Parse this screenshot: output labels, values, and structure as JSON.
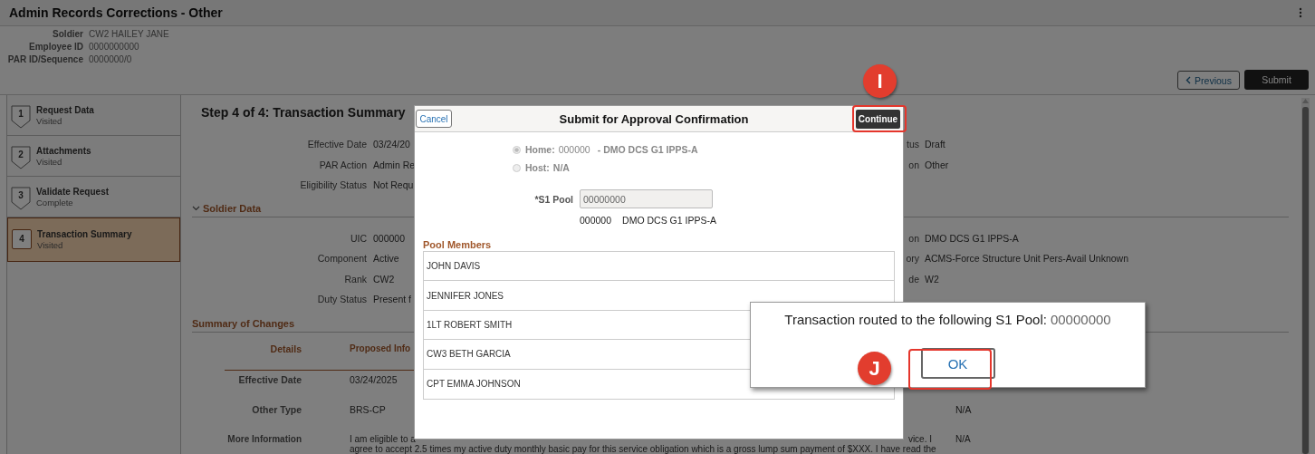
{
  "header": {
    "title": "Admin Records Corrections - Other"
  },
  "soldier_info": [
    {
      "label": "Soldier",
      "value": "CW2 HAILEY JANE"
    },
    {
      "label": "Employee ID",
      "value": "0000000000"
    },
    {
      "label": "PAR ID/Sequence",
      "value": "0000000/0"
    }
  ],
  "actions": {
    "previous": "Previous",
    "submit": "Submit"
  },
  "steps": [
    {
      "number": "1",
      "title": "Request Data",
      "status": "Visited",
      "selected": false
    },
    {
      "number": "2",
      "title": "Attachments",
      "status": "Visited",
      "selected": false
    },
    {
      "number": "3",
      "title": "Validate Request",
      "status": "Complete",
      "selected": false
    },
    {
      "number": "4",
      "title": "Transaction Summary",
      "status": "Visited",
      "selected": true
    }
  ],
  "main": {
    "step_title": "Step 4 of 4: Transaction Summary",
    "fields": [
      {
        "label": "Effective Date",
        "value": "03/24/20",
        "right_label": "tus",
        "right_value": "Draft"
      },
      {
        "label": "PAR Action",
        "value": "Admin Re",
        "right_label": "on",
        "right_value": "Other"
      },
      {
        "label": "Eligibility Status",
        "value": "Not Requ"
      }
    ],
    "soldier_data": {
      "title": "Soldier Data",
      "expanded": true,
      "fields": [
        {
          "label": "UIC",
          "value": "000000",
          "right_label": "on",
          "right_value": "DMO DCS G1 IPPS-A"
        },
        {
          "label": "Component",
          "value": "Active",
          "right_label": "ory",
          "right_value": "ACMS-Force Structure Unit Pers-Avail Unknown"
        },
        {
          "label": "Rank",
          "value": "CW2",
          "right_label": "de",
          "right_value": "W2"
        },
        {
          "label": "Duty Status",
          "value": "Present f"
        }
      ]
    },
    "summary_of_changes": {
      "title": "Summary of Changes",
      "columns": [
        "Details",
        "Proposed Info"
      ],
      "rows": [
        {
          "detail": "Effective Date",
          "proposed": "03/24/2025"
        },
        {
          "detail": "Other Type",
          "proposed": "BRS-CP",
          "current": "N/A"
        },
        {
          "detail": "More Information",
          "proposed": "I am eligible to a",
          "proposed_end": "vice. I",
          "proposed_line_2": "agree to accept 2.5 times my active duty monthly basic pay for this service obligation which is a gross lump sum payment of $XXX. I have read the",
          "current": "N/A"
        }
      ]
    }
  },
  "dialog": {
    "cancel": "Cancel",
    "title": "Submit for Approval Confirmation",
    "continue": "Continue",
    "routing": [
      {
        "label": "Home:",
        "code": "000000",
        "name": "- DMO DCS G1 IPPS-A",
        "selected": true,
        "disabled": true
      },
      {
        "label": "Host:",
        "name": "N/A",
        "selected": false,
        "disabled": true
      }
    ],
    "s1_pool": {
      "label": "*S1 Pool",
      "value": "00000000",
      "disabled": true
    },
    "s1_pool_code": "000000",
    "s1_pool_name": "DMO DCS G1 IPPS-A",
    "pool_members_title": "Pool Members",
    "pool_members": [
      "JOHN DAVIS",
      "JENNIFER JONES",
      "1LT ROBERT SMITH",
      "CW3 BETH GARCIA",
      "CPT EMMA JOHNSON"
    ]
  },
  "alert": {
    "message": "Transaction routed to the following S1 Pool:",
    "pool": "00000000",
    "ok": "OK"
  },
  "callouts": [
    "I",
    "J"
  ]
}
